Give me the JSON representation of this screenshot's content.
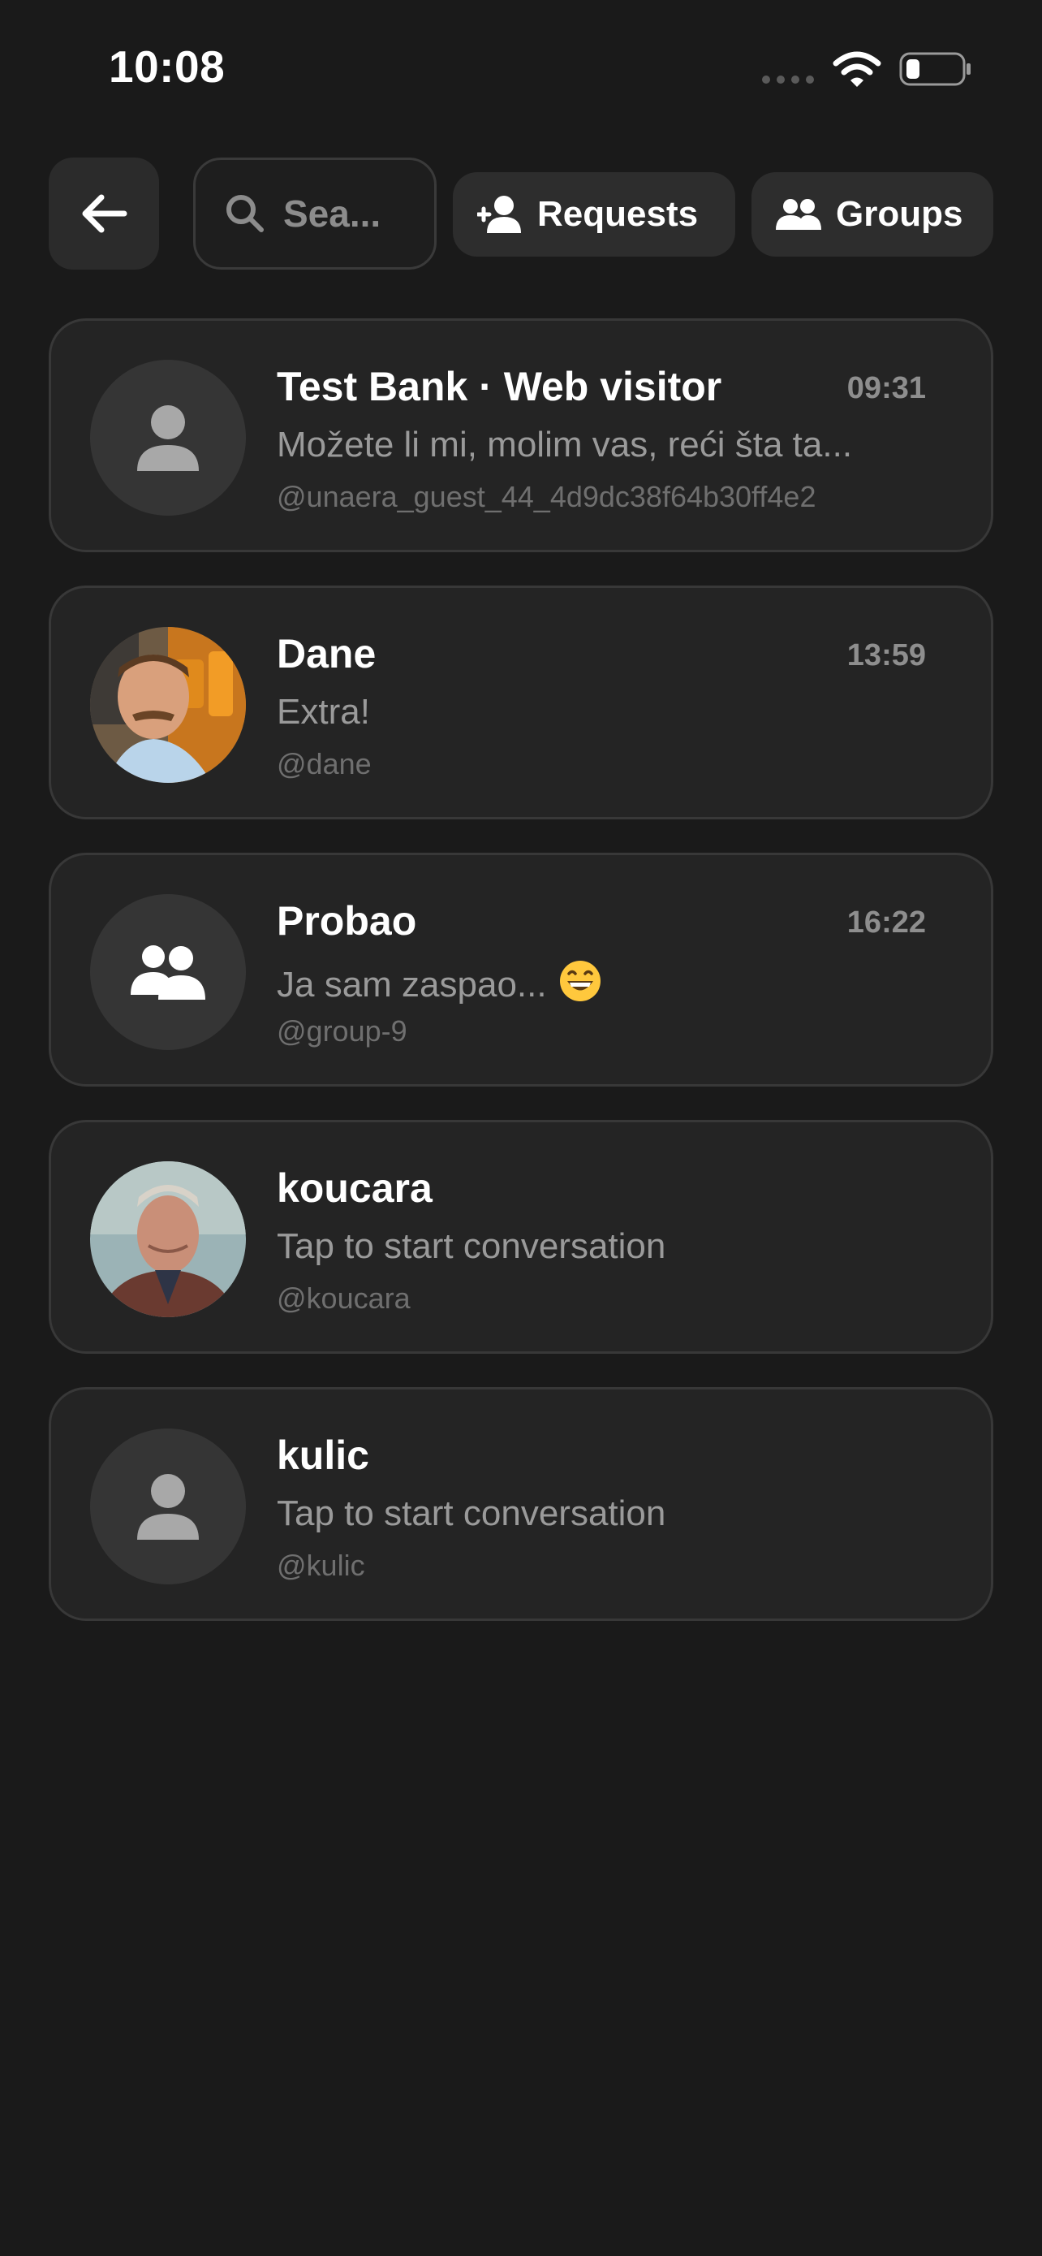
{
  "status_bar": {
    "time": "10:08"
  },
  "toolbar": {
    "back_icon": "arrow-left-icon",
    "search": {
      "placeholder": "Sea...",
      "value": "",
      "icon": "search-icon"
    },
    "requests_label": "Requests",
    "requests_icon": "person-add-icon",
    "groups_label": "Groups",
    "groups_icon": "group-icon"
  },
  "conversations": [
    {
      "name": "Test Bank · Web visitor",
      "time": "09:31",
      "preview": "Možete li mi, molim vas, reći šta ta...",
      "handle": "@unaera_guest_44_4d9dc38f64b30ff4e2",
      "avatar": "person-icon"
    },
    {
      "name": "Dane",
      "time": "13:59",
      "preview": "Extra!",
      "handle": "@dane",
      "avatar": "photo"
    },
    {
      "name": "Probao",
      "time": "16:22",
      "preview": "Ja sam zaspao...",
      "preview_emoji": "😁",
      "handle": "@group-9",
      "avatar": "group-icon"
    },
    {
      "name": "koucara",
      "time": "",
      "preview": "Tap to start conversation",
      "handle": "@koucara",
      "avatar": "photo"
    },
    {
      "name": "kulic",
      "time": "",
      "preview": "Tap to start conversation",
      "handle": "@kulic",
      "avatar": "person-icon"
    }
  ],
  "colors": {
    "background": "#1a1a1a",
    "card": "#242424",
    "card_border": "#383838",
    "button": "#2d2d2d",
    "secondary_text": "#9a9a9a",
    "handle_text": "#6f6f6f"
  }
}
